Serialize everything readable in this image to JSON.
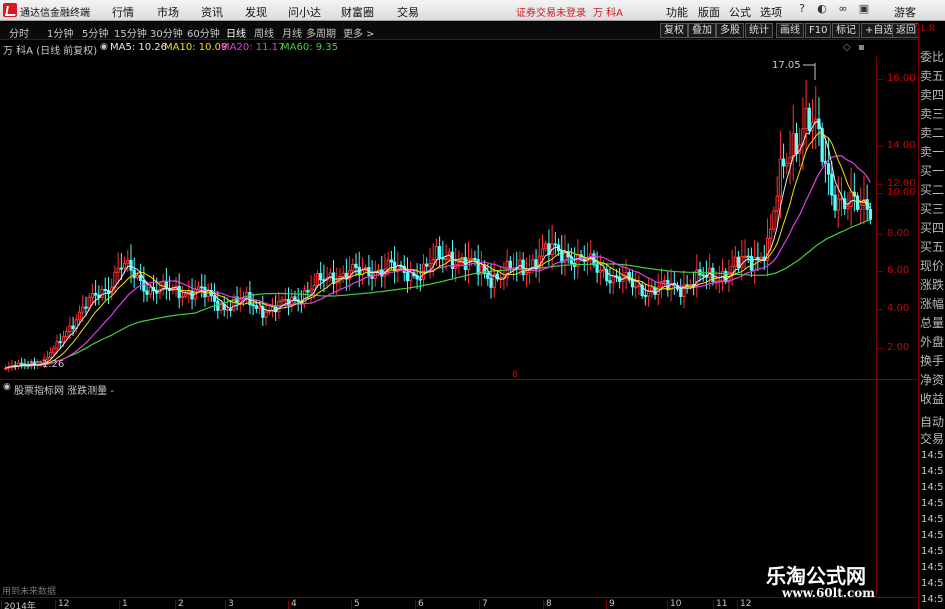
{
  "app": {
    "title": "通达信金融终端",
    "menu": [
      "行情",
      "市场",
      "资讯",
      "发现",
      "问小达",
      "财富圈",
      "交易"
    ],
    "status_text": "证券交易未登录",
    "stock_badge": "万 科A",
    "right_menu": [
      "功能",
      "版面",
      "公式",
      "选项"
    ],
    "user": "游客"
  },
  "toolbar": {
    "periods": [
      "分时",
      "1分钟",
      "5分钟",
      "15分钟",
      "30分钟",
      "60分钟",
      "日线",
      "周线",
      "月线",
      "多周期",
      "更多 >"
    ],
    "active_period": "日线",
    "right_buttons": [
      "复权",
      "叠加",
      "多股",
      "统计",
      "画线",
      "F10",
      "标记",
      "+自选",
      "返回"
    ]
  },
  "chart_header": {
    "stock": "万 科A (日线 前复权)",
    "ma5": "MA5: 10.26",
    "ma10": "MA10: 10.09",
    "ma20": "MA20: 11.17",
    "ma60": "MA60: 9.35"
  },
  "annotations": {
    "high": "17.05",
    "low": "1.26",
    "marker": "8"
  },
  "indicator": {
    "header": "股票指标网  涨跌测量 -",
    "footer_text": "用到未来数据"
  },
  "right_panel": {
    "corner": "L R",
    "items": [
      "委比",
      "卖五",
      "卖四",
      "卖三",
      "卖二",
      "卖一",
      "买一",
      "买二",
      "买三",
      "买四",
      "买五",
      "现价",
      "涨跌",
      "涨幅",
      "总量",
      "外盘",
      "换手",
      "净资",
      "收益"
    ],
    "items2": [
      "自动",
      "交易"
    ],
    "times": [
      "14:5",
      "14:5",
      "14:5",
      "14:5",
      "14:5",
      "14:5",
      "14:5",
      "14:5",
      "14:5",
      "14:5"
    ]
  },
  "watermark": {
    "line1": "乐淘公式网",
    "line2": "www.60lt.com"
  },
  "colors": {
    "up": "#ff3232",
    "down": "#54ffff",
    "ma5": "#e8e8e8",
    "ma10": "#f2e200",
    "ma20": "#e040e0",
    "ma60": "#40d040",
    "axis": "#d00000"
  },
  "chart_data": {
    "type": "line",
    "title": "万 科A (日线 前复权)",
    "yaxis_ticks": [
      "16.00",
      "14.00",
      "12.00",
      "10.00",
      "8.00",
      "6.00",
      "4.00",
      "2.00"
    ],
    "ylim": [
      1.0,
      17.5
    ],
    "xaxis_ticks": [
      "2014年",
      "12",
      "1",
      "2",
      "3",
      "4",
      "5",
      "6",
      "7",
      "8",
      "9",
      "10",
      "11",
      "12"
    ],
    "price_series": [
      1.26,
      1.4,
      1.5,
      1.6,
      2.4,
      3.5,
      4.4,
      5.0,
      5.6,
      6.9,
      6.2,
      5.7,
      5.5,
      5.3,
      5.4,
      5.5,
      5.0,
      4.6,
      4.8,
      4.8,
      4.5,
      4.4,
      4.7,
      5.1,
      5.6,
      5.9,
      6.3,
      6.5,
      6.2,
      6.6,
      6.8,
      6.3,
      6.4,
      6.6,
      7.1,
      7.4,
      6.9,
      6.6,
      6.3,
      6.2,
      6.5,
      6.8,
      7.3,
      7.5,
      7.6,
      7.0,
      6.8,
      6.6,
      6.0,
      5.8,
      5.6,
      5.4,
      5.6,
      5.7,
      5.9,
      6.1,
      6.3,
      6.5,
      6.9,
      7.3,
      7.9,
      11.6,
      13.8,
      14.6,
      13.2,
      11.0,
      10.0,
      9.8,
      10.2
    ],
    "ma_series": [
      {
        "name": "MA5",
        "value": "10.26"
      },
      {
        "name": "MA10",
        "value": "10.09"
      },
      {
        "name": "MA20",
        "value": "11.17"
      },
      {
        "name": "MA60",
        "value": "9.35"
      }
    ]
  }
}
